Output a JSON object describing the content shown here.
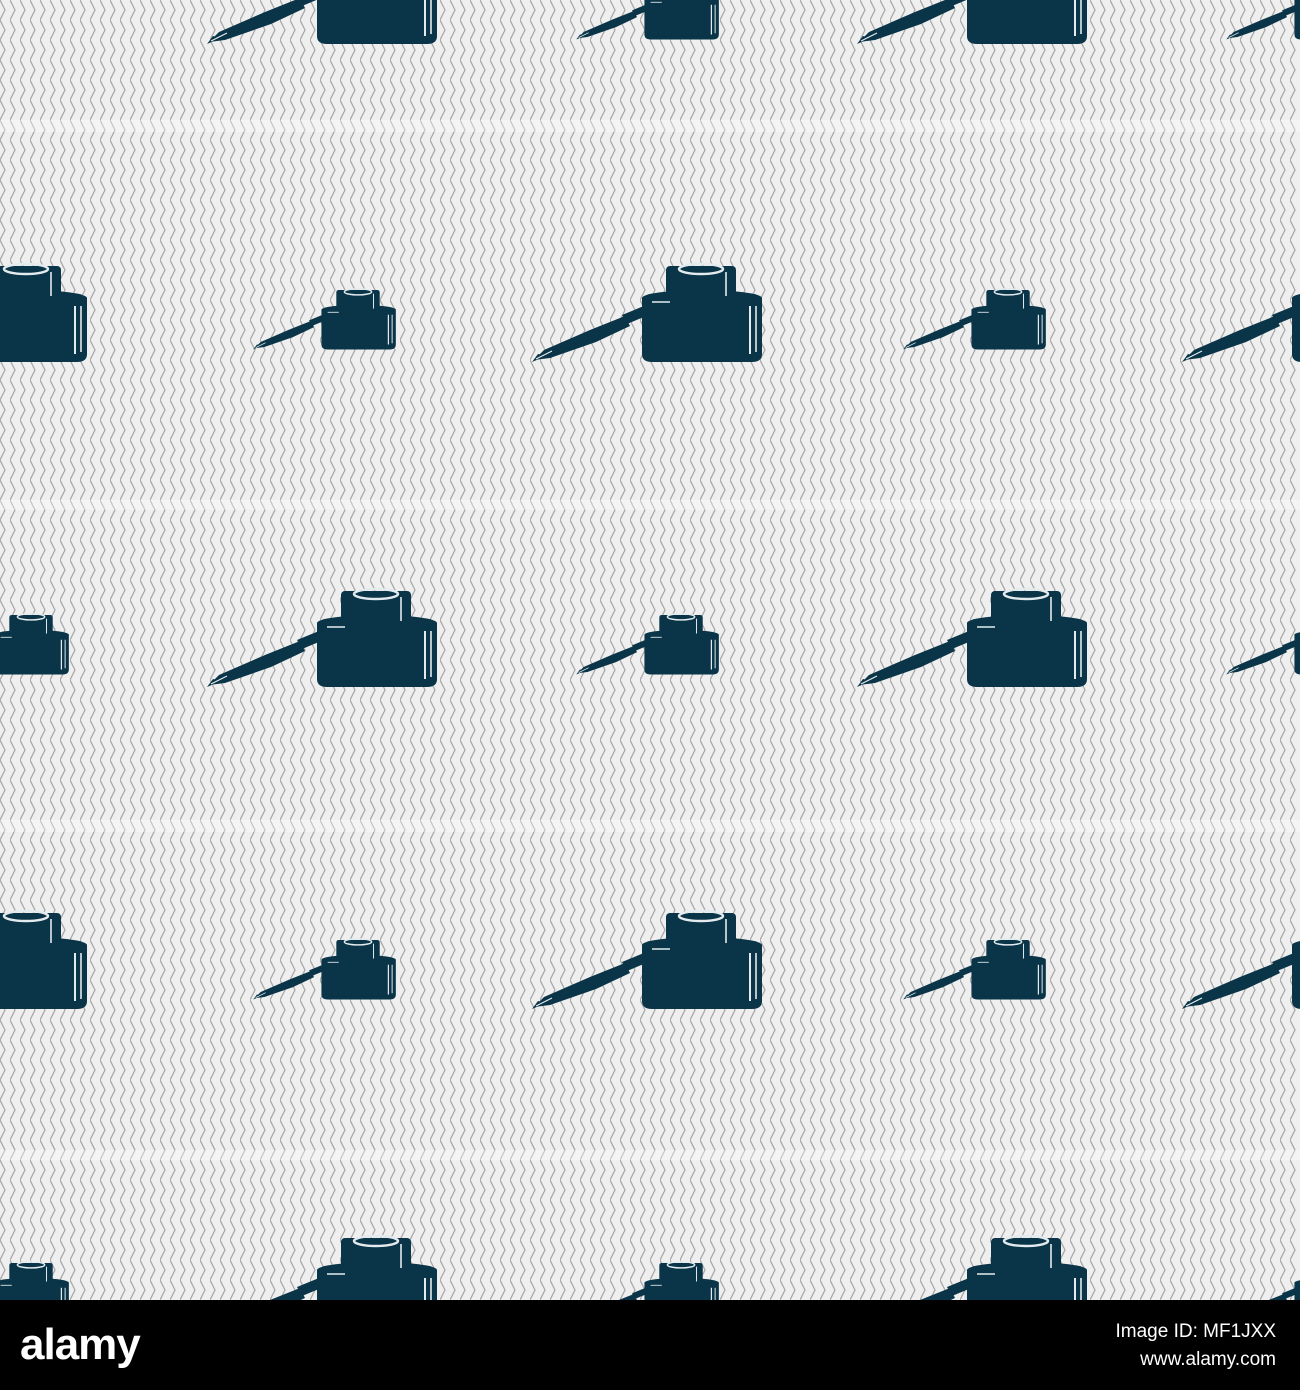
{
  "artwork": {
    "background_color": "#efefef",
    "zigzag_color": "#9c9c9c",
    "icon_color": "#0a3447",
    "highlight_color": "#e3ebee",
    "icon": "inkwell-with-fountain-pen-icon"
  },
  "footer": {
    "brand": "alamy",
    "image_id": "Image ID: MF1JXX",
    "url": "www.alamy.com",
    "background_color": "#000000",
    "text_color": "#ffffff"
  }
}
